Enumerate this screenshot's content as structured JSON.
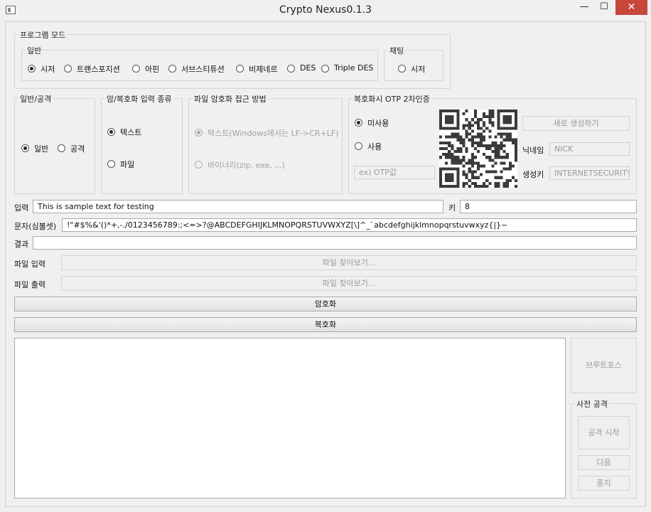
{
  "window": {
    "title": "Crypto Nexus0.1.3",
    "minimize_glyph": "—",
    "maximize_glyph": "☐",
    "close_glyph": "✕"
  },
  "program_mode": {
    "title": "프로그램 모드",
    "general": {
      "title": "일반",
      "options": [
        "시저",
        "트랜스포지션",
        "아핀",
        "서브스티튜션",
        "비제네르",
        "DES",
        "Triple DES"
      ],
      "selected": "시저"
    },
    "chat": {
      "title": "채팅",
      "options": [
        "시저"
      ]
    }
  },
  "general_attack": {
    "title": "일반/공격",
    "options": [
      "일반",
      "공격"
    ],
    "selected": "일반"
  },
  "input_type": {
    "title": "암/복호화 입력 종류",
    "options": [
      "텍스트",
      "파일"
    ],
    "selected": "텍스트"
  },
  "file_access": {
    "title": "파일 암호화 접근 방법",
    "options": [
      "텍스트(Windows에서는 LF->CR+LF)",
      "바이너리(zip, exe, ...)"
    ],
    "selected": "텍스트(Windows에서는 LF->CR+LF)"
  },
  "otp": {
    "title": "복호화시 OTP 2차인증",
    "options": [
      "미사용",
      "사용"
    ],
    "selected": "미사용",
    "otp_placeholder": "ex) OTP값",
    "generate_label": "새로 생성하기",
    "nickname_label": "닉네임",
    "nickname_value": "NICK",
    "generator_label": "생성키",
    "generator_value": "INTERNETSECURITY"
  },
  "fields": {
    "input_label": "입력",
    "input_value": "This is sample text for testing",
    "key_label": "키",
    "key_value": "8",
    "charset_label": "문자(심볼셋)",
    "charset_value": "!\"#$%&'()*+,-./0123456789:;<=>?@ABCDEFGHIJKLMNOPQRSTUVWXYZ[\\]^_`abcdefghijklmnopqrstuvwxyz{|}~",
    "result_label": "결과",
    "result_value": "",
    "file_in_label": "파일 입력",
    "file_in_button": "파일 찾아보기...",
    "file_out_label": "파일 출력",
    "file_out_button": "파일 찾아보기..."
  },
  "actions": {
    "encrypt": "암호화",
    "decrypt": "복호화"
  },
  "attack": {
    "brute_force": "브루트포스",
    "dict_title": "사전 공격",
    "start": "공격 시작",
    "next": "다음",
    "stop": "중지"
  },
  "colors": {
    "close": "#c7463c",
    "background": "#f0f0f0"
  },
  "icons": [
    "app-icon",
    "minimize-icon",
    "maximize-icon",
    "close-icon",
    "qr-code-icon"
  ]
}
